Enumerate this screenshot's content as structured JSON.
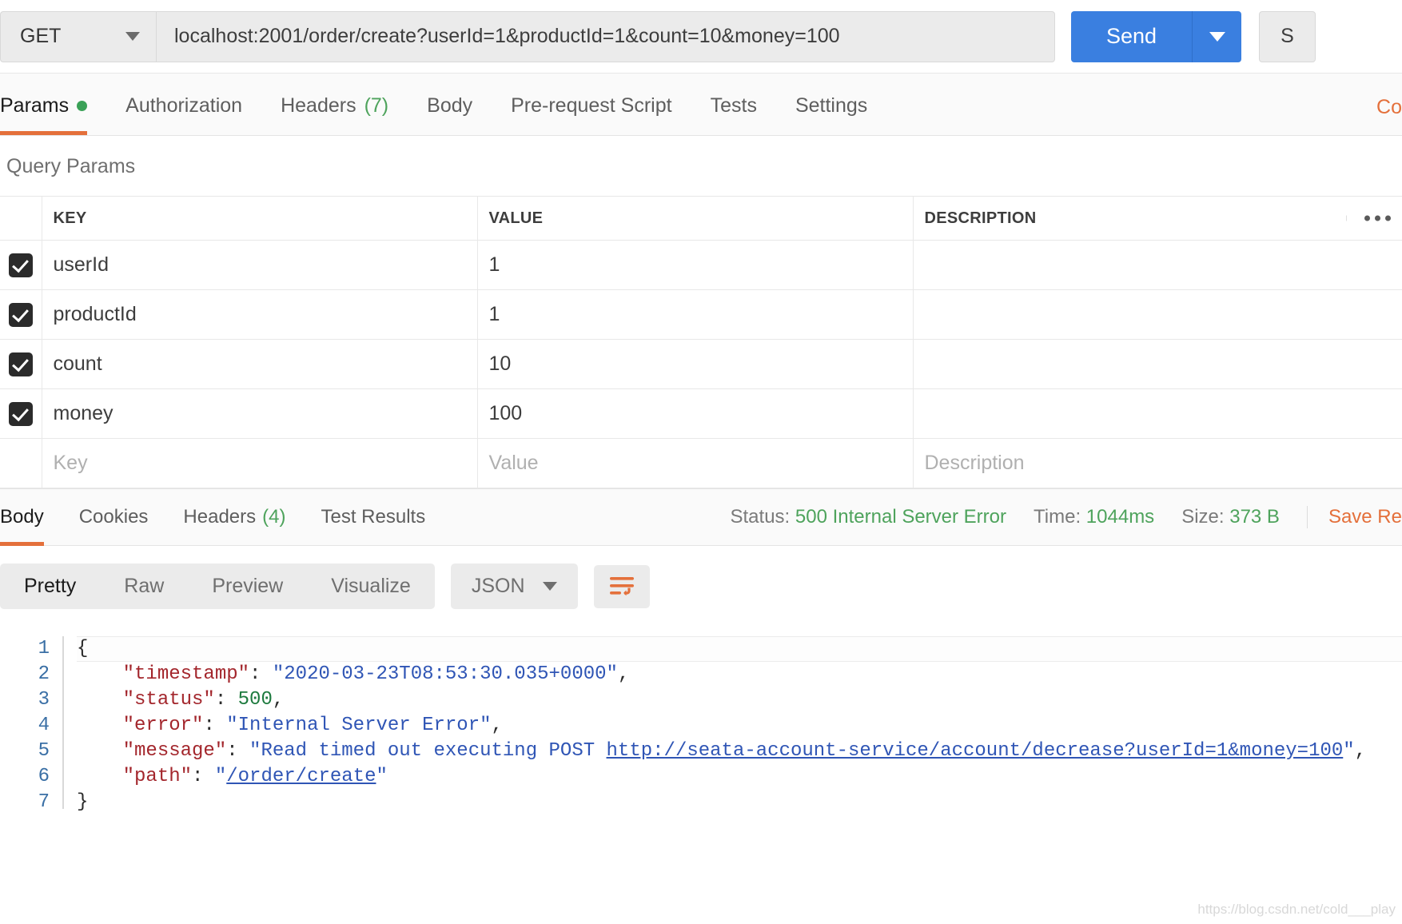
{
  "request": {
    "method": "GET",
    "url": "localhost:2001/order/create?userId=1&productId=1&count=10&money=100",
    "send_label": "Send",
    "save_label": "S",
    "tabs": [
      {
        "label": "Params",
        "badge": "",
        "active": true,
        "dot": true
      },
      {
        "label": "Authorization",
        "badge": "",
        "active": false,
        "dot": false
      },
      {
        "label": "Headers",
        "badge": "(7)",
        "active": false,
        "dot": false
      },
      {
        "label": "Body",
        "badge": "",
        "active": false,
        "dot": false
      },
      {
        "label": "Pre-request Script",
        "badge": "",
        "active": false,
        "dot": false
      },
      {
        "label": "Tests",
        "badge": "",
        "active": false,
        "dot": false
      },
      {
        "label": "Settings",
        "badge": "",
        "active": false,
        "dot": false
      }
    ],
    "cookies_link": "Co"
  },
  "params": {
    "section_title": "Query Params",
    "columns": [
      "KEY",
      "VALUE",
      "DESCRIPTION"
    ],
    "rows": [
      {
        "checked": true,
        "key": "userId",
        "value": "1",
        "description": ""
      },
      {
        "checked": true,
        "key": "productId",
        "value": "1",
        "description": ""
      },
      {
        "checked": true,
        "key": "count",
        "value": "10",
        "description": ""
      },
      {
        "checked": true,
        "key": "money",
        "value": "100",
        "description": ""
      }
    ],
    "placeholders": {
      "key": "Key",
      "value": "Value",
      "description": "Description"
    }
  },
  "response": {
    "tabs": [
      {
        "label": "Body",
        "badge": "",
        "active": true
      },
      {
        "label": "Cookies",
        "badge": "",
        "active": false
      },
      {
        "label": "Headers",
        "badge": "(4)",
        "active": false
      },
      {
        "label": "Test Results",
        "badge": "",
        "active": false
      }
    ],
    "status_label": "Status:",
    "status_value": "500 Internal Server Error",
    "time_label": "Time:",
    "time_value": "1044ms",
    "size_label": "Size:",
    "size_value": "373 B",
    "save_response": "Save Re",
    "view_modes": [
      {
        "label": "Pretty",
        "active": true
      },
      {
        "label": "Raw",
        "active": false
      },
      {
        "label": "Preview",
        "active": false
      },
      {
        "label": "Visualize",
        "active": false
      }
    ],
    "format": "JSON",
    "body_lines": [
      "1",
      "2",
      "3",
      "4",
      "5",
      "6",
      "7"
    ],
    "body": {
      "line1": "{",
      "line2_key": "\"timestamp\"",
      "line2_val": "\"2020-03-23T08:53:30.035+0000\"",
      "line3_key": "\"status\"",
      "line3_val": "500",
      "line4_key": "\"error\"",
      "line4_val": "\"Internal Server Error\"",
      "line5_key": "\"message\"",
      "line5_val_pre": "\"Read timed out executing POST ",
      "line5_link": "http://seata-account-service/account/decrease?userId=1&money=100",
      "line5_val_post": "\"",
      "line6_key": "\"path\"",
      "line6_quote": "\"",
      "line6_link": "/order/create",
      "line7": "}"
    }
  },
  "colors": {
    "accent_orange": "#e4703b",
    "send_blue": "#3a7fe0",
    "success_green": "#4ea35c",
    "json_key": "#a3262c",
    "json_string": "#2f55b5",
    "json_number": "#1d7a3e"
  },
  "watermark": "https://blog.csdn.net/cold___play"
}
